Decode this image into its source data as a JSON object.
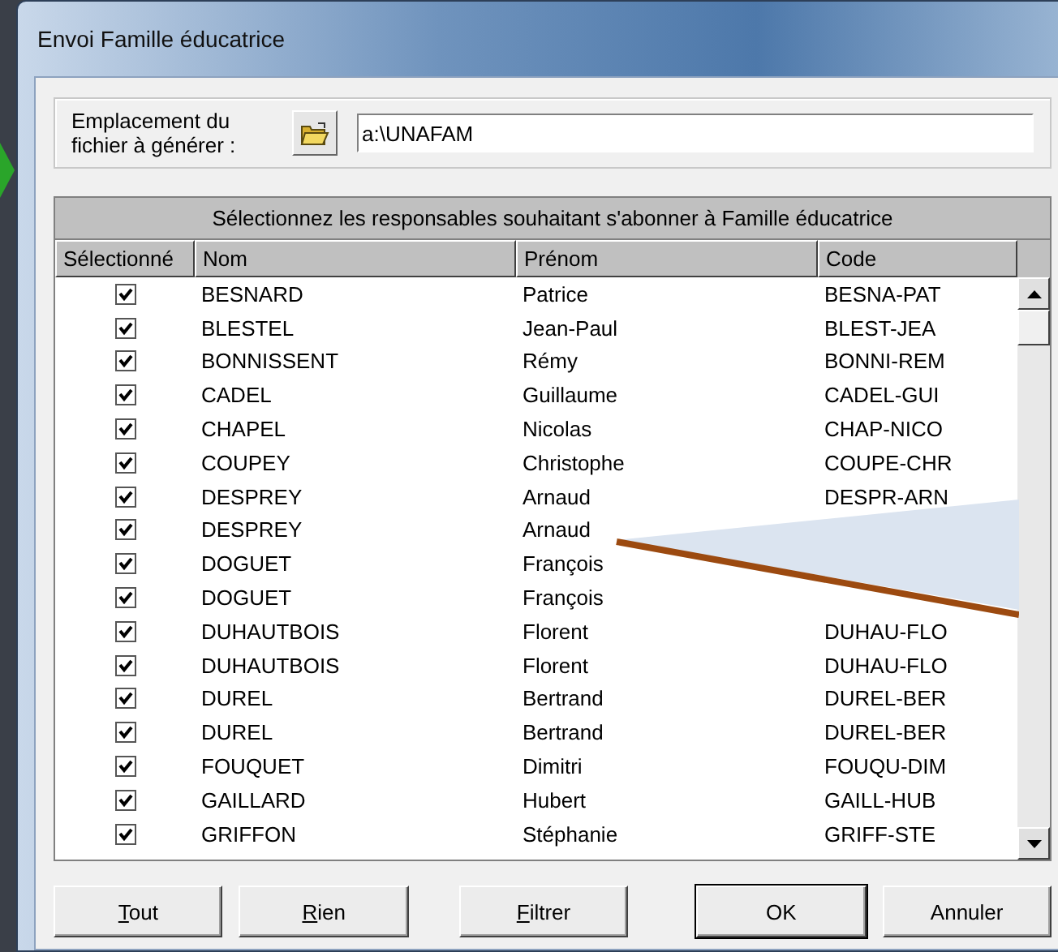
{
  "window": {
    "title": "Envoi Famille éducatrice"
  },
  "location": {
    "label": "Emplacement du fichier à générer :",
    "value": "a:\\UNAFAM"
  },
  "table": {
    "title": "Sélectionnez les responsables souhaitant s'abonner à Famille éducatrice",
    "columns": [
      "Sélectionné",
      "Nom",
      "Prénom",
      "Code"
    ],
    "rows": [
      {
        "checked": true,
        "nom": "BESNARD",
        "prenom": "Patrice",
        "code": "BESNA-PAT"
      },
      {
        "checked": true,
        "nom": "BLESTEL",
        "prenom": "Jean-Paul",
        "code": "BLEST-JEA"
      },
      {
        "checked": true,
        "nom": "BONNISSENT",
        "prenom": "Rémy",
        "code": "BONNI-REM"
      },
      {
        "checked": true,
        "nom": "CADEL",
        "prenom": "Guillaume",
        "code": "CADEL-GUI"
      },
      {
        "checked": true,
        "nom": "CHAPEL",
        "prenom": "Nicolas",
        "code": "CHAP-NICO"
      },
      {
        "checked": true,
        "nom": "COUPEY",
        "prenom": "Christophe",
        "code": "COUPE-CHR"
      },
      {
        "checked": true,
        "nom": "DESPREY",
        "prenom": "Arnaud",
        "code": "DESPR-ARN"
      },
      {
        "checked": true,
        "nom": "DESPREY",
        "prenom": "Arnaud"
      },
      {
        "checked": true,
        "nom": "DOGUET",
        "prenom": "François"
      },
      {
        "checked": true,
        "nom": "DOGUET",
        "prenom": "François"
      },
      {
        "checked": true,
        "nom": "DUHAUTBOIS",
        "prenom": "Florent",
        "code": "DUHAU-FLO"
      },
      {
        "checked": true,
        "nom": "DUHAUTBOIS",
        "prenom": "Florent",
        "code": "DUHAU-FLO"
      },
      {
        "checked": true,
        "nom": "DUREL",
        "prenom": "Bertrand",
        "code": "DUREL-BER"
      },
      {
        "checked": true,
        "nom": "DUREL",
        "prenom": "Bertrand",
        "code": "DUREL-BER"
      },
      {
        "checked": true,
        "nom": "FOUQUET",
        "prenom": "Dimitri",
        "code": "FOUQU-DIM"
      },
      {
        "checked": true,
        "nom": "GAILLARD",
        "prenom": "Hubert",
        "code": "GAILL-HUB"
      },
      {
        "checked": true,
        "nom": "GRIFFON",
        "prenom": "Stéphanie",
        "code": "GRIFF-STE"
      }
    ]
  },
  "buttons": [
    {
      "label": "Tout",
      "mnemonic": true,
      "default": false
    },
    {
      "label": "Rien",
      "mnemonic": true,
      "default": false
    },
    {
      "label": "Filtrer",
      "mnemonic": true,
      "default": false
    },
    {
      "label": "OK",
      "mnemonic": false,
      "default": true
    },
    {
      "label": "Annuler",
      "mnemonic": false,
      "default": false
    }
  ]
}
